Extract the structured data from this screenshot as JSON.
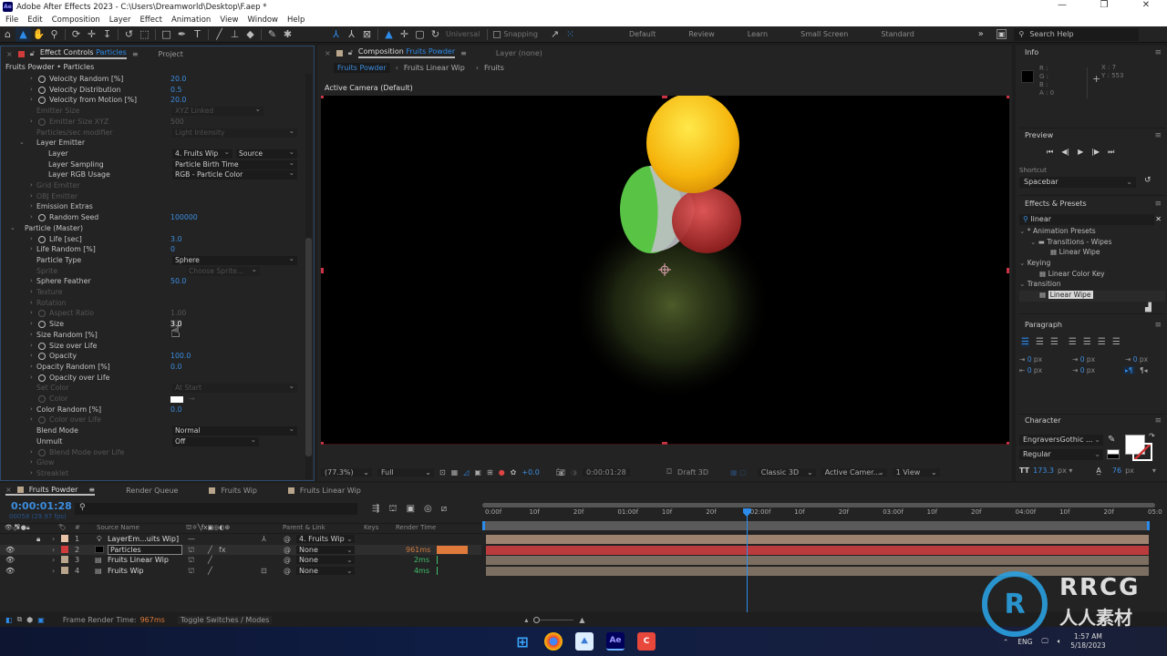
{
  "window": {
    "title": "Adobe After Effects 2023 - C:\\Users\\Dreamworld\\Desktop\\F.aep *",
    "app_logo": "Ae",
    "minimize": "—",
    "restore": "❐",
    "close": "✕"
  },
  "menu": [
    "File",
    "Edit",
    "Composition",
    "Layer",
    "Effect",
    "Animation",
    "View",
    "Window",
    "Help"
  ],
  "toolbar": {
    "axis_mode": "Universal",
    "snapping": "Snapping",
    "workspaces": [
      "Default",
      "Review",
      "Learn",
      "Small Screen",
      "Standard"
    ],
    "more": "»",
    "search_help": "Search Help"
  },
  "effect_controls": {
    "tab_label": "Effect Controls",
    "tab_layer": "Particles",
    "project_tab": "Project",
    "breadcrumb": "Fruits Powder • Particles",
    "rows": [
      {
        "label": "Velocity Random [%]",
        "value": "20.0",
        "indent": 2,
        "stopwatch": true,
        "arrow": true,
        "dim": false
      },
      {
        "label": "Velocity Distribution",
        "value": "0.5",
        "indent": 2,
        "stopwatch": true,
        "arrow": true,
        "dim": false
      },
      {
        "label": "Velocity from Motion [%]",
        "value": "20.0",
        "indent": 2,
        "stopwatch": true,
        "arrow": true,
        "dim": false
      },
      {
        "label": "Emitter Size",
        "dropdown": "XYZ Linked",
        "indent": 2,
        "dim": true
      },
      {
        "label": "Emitter Size XYZ",
        "value": "500",
        "indent": 2,
        "stopwatch": true,
        "arrow": true,
        "dim": true
      },
      {
        "label": "Particles/sec modifier",
        "dropdown": "Light Intensity",
        "indent": 2,
        "dim": true,
        "wide": true
      },
      {
        "label": "Layer Emitter",
        "indent": 1,
        "expanded": true,
        "dim": false
      },
      {
        "label": "Layer",
        "dropdown": "4. Fruits  Wip",
        "dropdown2": "Source",
        "indent": 3,
        "dim": false
      },
      {
        "label": "Layer Sampling",
        "dropdown": "Particle Birth Time",
        "indent": 3,
        "dim": false,
        "wide": true
      },
      {
        "label": "Layer RGB Usage",
        "dropdown": "RGB - Particle Color",
        "indent": 3,
        "dim": false,
        "wide": true
      },
      {
        "label": "Grid Emitter",
        "indent": 2,
        "arrow": true,
        "dim": true
      },
      {
        "label": "OBJ Emitter",
        "indent": 2,
        "arrow": true,
        "dim": true
      },
      {
        "label": "Emission Extras",
        "indent": 2,
        "arrow": true,
        "dim": false
      },
      {
        "label": "Random Seed",
        "value": "100000",
        "indent": 2,
        "stopwatch": true,
        "arrow": true,
        "dim": false
      },
      {
        "label": "Particle (Master)",
        "indent": 0,
        "expanded": true,
        "dim": false
      },
      {
        "label": "Life [sec]",
        "value": "3.0",
        "indent": 2,
        "stopwatch": true,
        "arrow": true,
        "dim": false
      },
      {
        "label": "Life Random [%]",
        "value": "0",
        "indent": 2,
        "arrow": true,
        "dim": false
      },
      {
        "label": "Particle Type",
        "dropdown": "Sphere",
        "indent": 2,
        "dim": false,
        "wide": true
      },
      {
        "label": "Sprite",
        "button": "Choose Sprite...",
        "indent": 2,
        "dim": true
      },
      {
        "label": "Sphere Feather",
        "value": "50.0",
        "indent": 2,
        "arrow": true,
        "dim": false
      },
      {
        "label": "Texture",
        "indent": 2,
        "arrow": true,
        "dim": true
      },
      {
        "label": "Rotation",
        "indent": 2,
        "arrow": true,
        "dim": true
      },
      {
        "label": "Aspect Ratio",
        "value": "1.00",
        "indent": 2,
        "stopwatch": true,
        "arrow": true,
        "dim": true
      },
      {
        "label": "Size",
        "value": "3.0",
        "indent": 2,
        "stopwatch": true,
        "arrow": true,
        "dim": false,
        "scrubbing": true
      },
      {
        "label": "Size Random [%]",
        "value": "",
        "indent": 2,
        "arrow": true,
        "dim": false
      },
      {
        "label": "Size over Life",
        "indent": 2,
        "stopwatch": true,
        "arrow": true,
        "dim": false
      },
      {
        "label": "Opacity",
        "value": "100.0",
        "indent": 2,
        "stopwatch": true,
        "arrow": true,
        "dim": false
      },
      {
        "label": "Opacity Random [%]",
        "value": "0.0",
        "indent": 2,
        "arrow": true,
        "dim": false
      },
      {
        "label": "Opacity over Life",
        "indent": 2,
        "stopwatch": true,
        "arrow": true,
        "dim": false
      },
      {
        "label": "Set Color",
        "dropdown": "At Start",
        "indent": 2,
        "dim": true,
        "wide": true
      },
      {
        "label": "Color",
        "swatch": "#ffffff",
        "indent": 2,
        "stopwatch": true,
        "dim": true
      },
      {
        "label": "Color Random [%]",
        "value": "0.0",
        "indent": 2,
        "arrow": true,
        "dim": false
      },
      {
        "label": "Color over Life",
        "indent": 2,
        "stopwatch": true,
        "arrow": true,
        "dim": true
      },
      {
        "label": "Blend Mode",
        "dropdown": "Normal",
        "indent": 2,
        "dim": false,
        "wide": true
      },
      {
        "label": "Unmult",
        "dropdown": "Off",
        "indent": 2,
        "dim": false
      },
      {
        "label": "Blend Mode over Life",
        "indent": 2,
        "stopwatch": true,
        "arrow": true,
        "dim": true
      },
      {
        "label": "Glow",
        "indent": 2,
        "arrow": true,
        "dim": true
      },
      {
        "label": "Streaklet",
        "indent": 2,
        "arrow": true,
        "dim": true
      }
    ]
  },
  "composition": {
    "tab_label": "Composition",
    "tab_name": "Fruits Powder",
    "layer_tab": "Layer  (none)",
    "flow": [
      "Fruits Powder",
      "Fruits Linear  Wip",
      "Fruits"
    ],
    "camera_label": "Active Camera (Default)",
    "footer": {
      "zoom": "(77.3%)",
      "resolution": "Full",
      "exposure": "+0.0",
      "timecode": "0:00:01:28",
      "draft3d": "Draft 3D",
      "renderer": "Classic 3D",
      "camera": "Active Camer...",
      "views": "1 View"
    }
  },
  "info": {
    "title": "Info",
    "r": "R :",
    "g": "G :",
    "b": "B :",
    "a": "A :  0",
    "x": "X : 7",
    "y": "Y : 553"
  },
  "preview": {
    "title": "Preview",
    "shortcut_label": "Shortcut",
    "shortcut_value": "Spacebar"
  },
  "effects_presets": {
    "title": "Effects & Presets",
    "search": "linear",
    "tree": [
      {
        "label": "* Animation Presets",
        "level": 0
      },
      {
        "label": "Transitions - Wipes",
        "level": 1,
        "folder": true
      },
      {
        "label": "Linear Wipe",
        "level": 2
      },
      {
        "label": "Keying",
        "level": 0
      },
      {
        "label": "Linear Color Key",
        "level": 1
      },
      {
        "label": "Transition",
        "level": 0
      },
      {
        "label": "Linear Wipe",
        "level": 1,
        "selected": true
      }
    ]
  },
  "paragraph": {
    "title": "Paragraph",
    "indent_left": "0 px",
    "indent_first": "0 px",
    "space_before": "0 px",
    "space_after": "0 px",
    "indent_right": "0 px",
    "unit": "px"
  },
  "character": {
    "title": "Character",
    "font": "EngraversGothic ...",
    "style": "Regular",
    "size": "173.3",
    "size_unit": "px ▾",
    "tracking": "76",
    "tracking_unit": "px"
  },
  "timeline": {
    "tabs": [
      "Fruits Powder",
      "Render Queue",
      "Fruits  Wip",
      "Fruits Linear  Wip"
    ],
    "tab_colors": [
      "#b8a58c",
      "",
      "#b8a58c",
      "#b8a58c"
    ],
    "timecode": "0:00:01:28",
    "frame_info": "00058 (29.97 fps)",
    "columns": {
      "source_name": "Source Name",
      "parent": "Parent & Link",
      "keys": "Keys",
      "render_time": "Render Time",
      "num": "#"
    },
    "layers": [
      {
        "num": "1",
        "name": "LayerEm...uits  Wip]",
        "color": "#e8c3a8",
        "parent": "4. Fruits  Wip",
        "render": "",
        "locked": true,
        "visible": false,
        "bar_color": "#9e8270"
      },
      {
        "num": "2",
        "name": "Particles",
        "color": "#d03b3b",
        "parent": "None",
        "render": "961ms",
        "render_color": "#d07a3e",
        "selected": true,
        "visible": true,
        "bar_color": "#bb3a3c"
      },
      {
        "num": "3",
        "name": "Fruits Linear  Wip",
        "color": "#b8a58c",
        "parent": "None",
        "render": "2ms",
        "render_color": "#3fbf6a",
        "visible": true,
        "bar_color": "#7c6e60"
      },
      {
        "num": "4",
        "name": "Fruits  Wip",
        "color": "#b8a58c",
        "parent": "None",
        "render": "4ms",
        "render_color": "#3fbf6a",
        "visible": true,
        "bar_color": "#7c6e60"
      }
    ],
    "ruler": [
      "0:00f",
      "10f",
      "20f",
      "01:00f",
      "10f",
      "20f",
      "02:00f",
      "10f",
      "20f",
      "03:00f",
      "10f",
      "20f",
      "04:00f",
      "10f",
      "20f",
      "05:0"
    ],
    "playhead_fraction": 0.393
  },
  "status": {
    "frame_render_label": "Frame Render Time:",
    "frame_render_value": "967ms",
    "toggle": "Toggle Switches / Modes"
  },
  "taskbar": {
    "lang": "ENG",
    "time": "1:57 AM",
    "date": "5/18/2023"
  },
  "watermark": {
    "brand": "RRCG",
    "sub": "人人素材"
  }
}
